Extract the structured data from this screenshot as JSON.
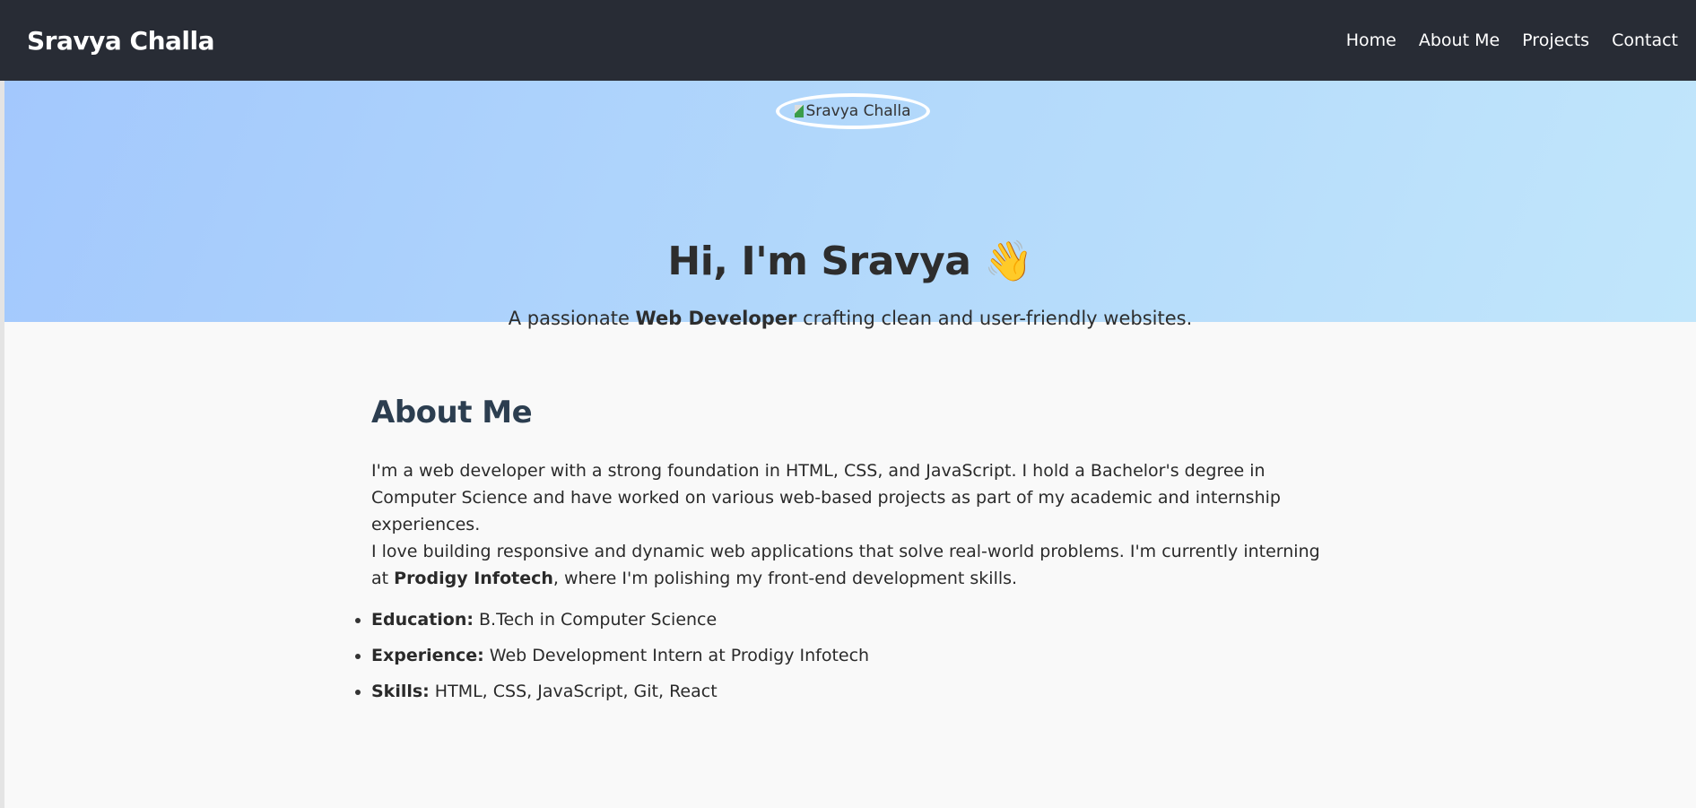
{
  "nav": {
    "brand": "Sravya Challa",
    "links": [
      "Home",
      "About Me",
      "Projects",
      "Contact"
    ]
  },
  "hero": {
    "avatar_alt": "Sravya Challa",
    "title": "Hi, I'm Sravya",
    "emoji": "👋",
    "subtitle_pre": "A passionate ",
    "subtitle_bold": "Web Developer",
    "subtitle_post": " crafting clean and user-friendly websites."
  },
  "about": {
    "heading": "About Me",
    "p1": "I'm a web developer with a strong foundation in HTML, CSS, and JavaScript. I hold a Bachelor's degree in Computer Science and have worked on various web-based projects as part of my academic and internship experiences.",
    "p2_pre": "I love building responsive and dynamic web applications that solve real-world problems. I'm currently interning at ",
    "p2_bold": "Prodigy Infotech",
    "p2_post": ", where I'm polishing my front-end development skills.",
    "items": [
      {
        "label": "Education:",
        "value": " B.Tech in Computer Science"
      },
      {
        "label": "Experience:",
        "value": " Web Development Intern at Prodigy Infotech"
      },
      {
        "label": "Skills:",
        "value": " HTML, CSS, JavaScript, Git, React"
      }
    ]
  },
  "colors": {
    "nav_bg": "#282c35",
    "heading": "#2c3e50",
    "hero_gradient_start": "#a3c8fd",
    "hero_gradient_end": "#c1e6fb"
  }
}
